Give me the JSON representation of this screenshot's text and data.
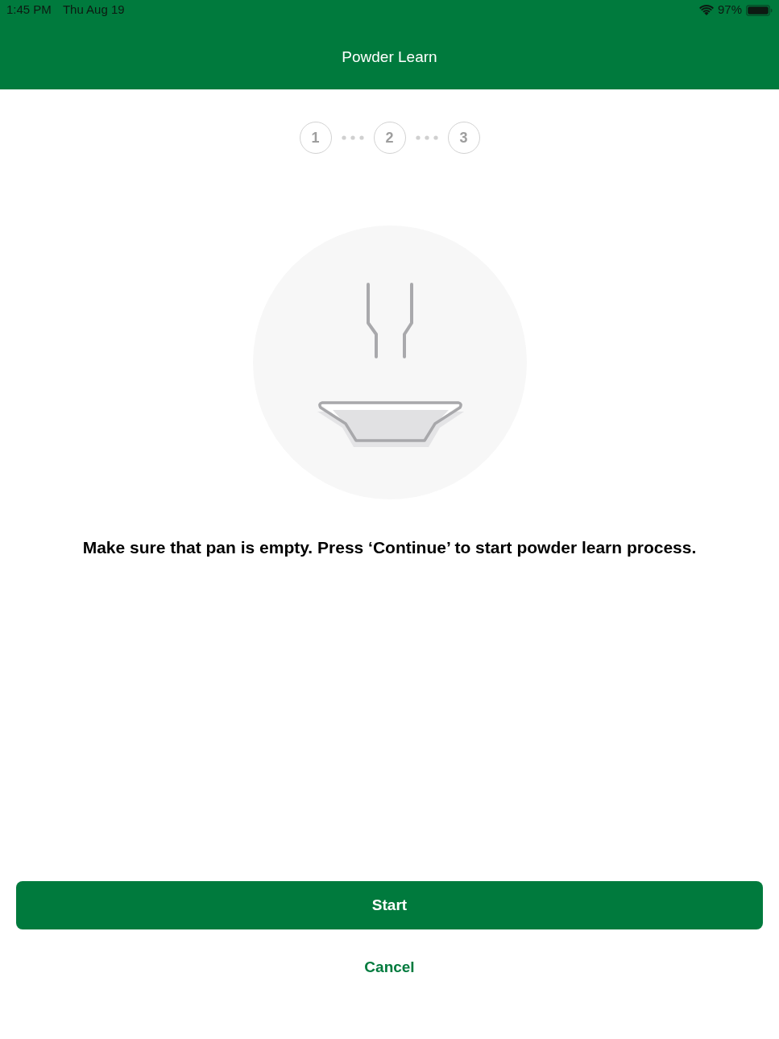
{
  "status_bar": {
    "time": "1:45 PM",
    "date": "Thu Aug 19",
    "battery": "97%"
  },
  "nav_bar": {
    "title": "Powder Learn"
  },
  "steps": [
    {
      "label": "1",
      "selected": false
    },
    {
      "label": "2",
      "selected": false
    },
    {
      "label": "3",
      "selected": false
    }
  ],
  "instruction": "Make sure that pan is empty. Press ‘Continue’ to start powder learn process.",
  "buttons": [
    {
      "kind": "primary",
      "label": "Start"
    },
    {
      "kind": "link",
      "label": "Cancel"
    }
  ]
}
